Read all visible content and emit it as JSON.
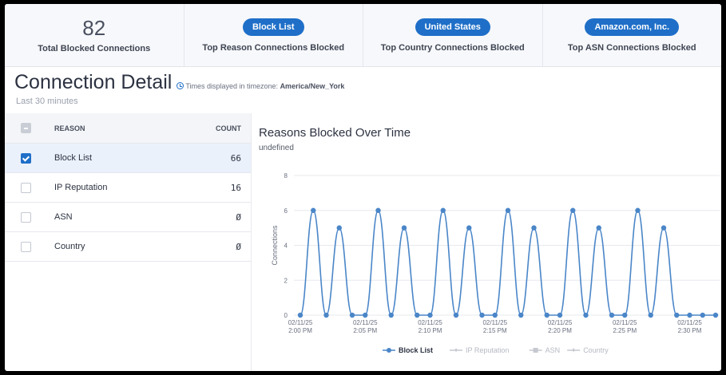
{
  "stats": [
    {
      "kind": "number",
      "value": "82",
      "label": "Total Blocked Connections"
    },
    {
      "kind": "pill",
      "value": "Block List",
      "label": "Top Reason Connections Blocked"
    },
    {
      "kind": "pill",
      "value": "United States",
      "label": "Top Country Connections Blocked"
    },
    {
      "kind": "pill",
      "value": "Amazon.com, Inc.",
      "label": "Top ASN Connections Blocked"
    }
  ],
  "detail": {
    "title": "Connection Detail",
    "timezone_prefix": "Times displayed in timezone: ",
    "timezone": "America/New_York",
    "time_range": "Last 30 minutes"
  },
  "table": {
    "headers": {
      "reason": "REASON",
      "count": "COUNT"
    },
    "rows": [
      {
        "reason": "Block List",
        "count": "66",
        "checked": true
      },
      {
        "reason": "IP Reputation",
        "count": "16",
        "checked": false
      },
      {
        "reason": "ASN",
        "count": "0",
        "checked": false
      },
      {
        "reason": "Country",
        "count": "0",
        "checked": false
      }
    ]
  },
  "chart": {
    "title": "Reasons Blocked Over Time",
    "subtitle": "undefined"
  },
  "colors": {
    "accent": "#1f6fc8",
    "series": "#4a86c8",
    "muted": "#c5c8d0"
  },
  "chart_data": {
    "type": "line",
    "ylabel": "Connections",
    "ylim": [
      0,
      8
    ],
    "yticks": [
      0,
      2,
      4,
      6,
      8
    ],
    "xticks": [
      {
        "i": 0,
        "date": "02/11/25",
        "time": "2:00 PM"
      },
      {
        "i": 5,
        "date": "02/11/25",
        "time": "2:05 PM"
      },
      {
        "i": 10,
        "date": "02/11/25",
        "time": "2:10 PM"
      },
      {
        "i": 15,
        "date": "02/11/25",
        "time": "2:15 PM"
      },
      {
        "i": 20,
        "date": "02/11/25",
        "time": "2:20 PM"
      },
      {
        "i": 25,
        "date": "02/11/25",
        "time": "2:25 PM"
      },
      {
        "i": 30,
        "date": "02/11/25",
        "time": "2:30 PM"
      }
    ],
    "series": [
      {
        "name": "Block List",
        "active": true,
        "values": [
          0,
          6,
          0,
          5,
          0,
          0,
          6,
          0,
          5,
          0,
          0,
          6,
          0,
          5,
          0,
          0,
          6,
          0,
          5,
          0,
          0,
          6,
          0,
          5,
          0,
          0,
          6,
          0,
          5,
          0,
          0,
          0,
          0
        ]
      },
      {
        "name": "IP Reputation",
        "active": false,
        "values": []
      },
      {
        "name": "ASN",
        "active": false,
        "values": []
      },
      {
        "name": "Country",
        "active": false,
        "values": []
      }
    ],
    "grid": true,
    "legend": "bottom-center"
  }
}
